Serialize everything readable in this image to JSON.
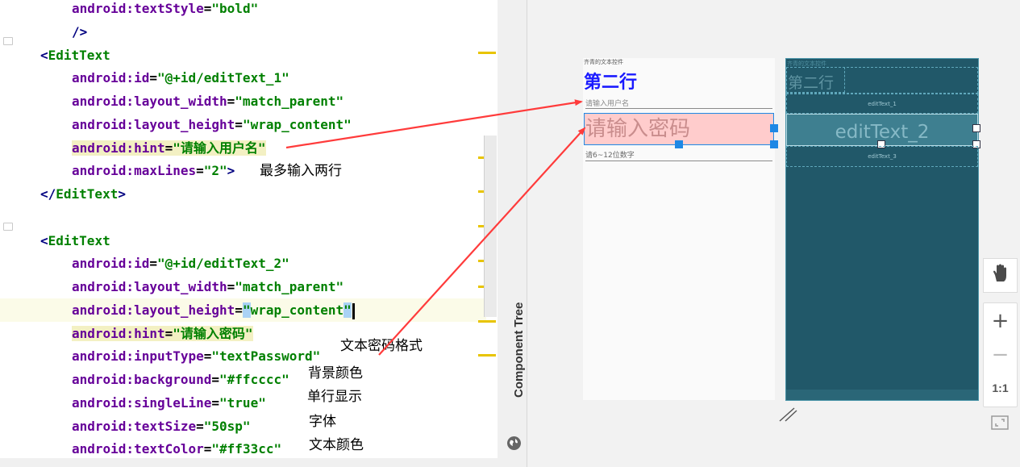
{
  "editor": {
    "lines": [
      {
        "indent": 2,
        "parts": [
          {
            "cls": "attr",
            "text": "android:textStyle"
          },
          {
            "cls": "",
            "text": "="
          },
          {
            "cls": "val",
            "text": "\"bold\""
          }
        ]
      },
      {
        "indent": 2,
        "parts": [
          {
            "cls": "tag",
            "text": "/>"
          }
        ]
      },
      {
        "indent": 1,
        "parts": [
          {
            "cls": "tag",
            "text": "<"
          },
          {
            "cls": "tagname",
            "text": "EditText"
          }
        ]
      },
      {
        "indent": 2,
        "parts": [
          {
            "cls": "attr",
            "text": "android:id"
          },
          {
            "cls": "",
            "text": "="
          },
          {
            "cls": "val",
            "text": "\"@+id/editText_1\""
          }
        ]
      },
      {
        "indent": 2,
        "parts": [
          {
            "cls": "attr",
            "text": "android:layout_width"
          },
          {
            "cls": "",
            "text": "="
          },
          {
            "cls": "val",
            "text": "\"match_parent\""
          }
        ]
      },
      {
        "indent": 2,
        "parts": [
          {
            "cls": "attr",
            "text": "android:layout_height"
          },
          {
            "cls": "",
            "text": "="
          },
          {
            "cls": "val",
            "text": "\"wrap_content\""
          }
        ]
      },
      {
        "indent": 2,
        "parts": [
          {
            "cls": "attr hintbg",
            "text": "android:hint"
          },
          {
            "cls": "hintbg",
            "text": "="
          },
          {
            "cls": "val hintbg",
            "text": "\"请输入用户名\""
          }
        ]
      },
      {
        "indent": 2,
        "parts": [
          {
            "cls": "attr",
            "text": "android:maxLines"
          },
          {
            "cls": "",
            "text": "="
          },
          {
            "cls": "val",
            "text": "\"2\""
          },
          {
            "cls": "tag",
            "text": ">"
          }
        ]
      },
      {
        "indent": 1,
        "parts": [
          {
            "cls": "tag",
            "text": "</"
          },
          {
            "cls": "tagname",
            "text": "EditText"
          },
          {
            "cls": "tag",
            "text": ">"
          }
        ]
      },
      {
        "indent": 0,
        "parts": []
      },
      {
        "indent": 1,
        "parts": [
          {
            "cls": "tag",
            "text": "<"
          },
          {
            "cls": "tagname",
            "text": "EditText"
          }
        ]
      },
      {
        "indent": 2,
        "parts": [
          {
            "cls": "attr",
            "text": "android:id"
          },
          {
            "cls": "",
            "text": "="
          },
          {
            "cls": "val",
            "text": "\"@+id/editText_2\""
          }
        ]
      },
      {
        "indent": 2,
        "parts": [
          {
            "cls": "attr",
            "text": "android:layout_width"
          },
          {
            "cls": "",
            "text": "="
          },
          {
            "cls": "val",
            "text": "\"match_parent\""
          }
        ]
      },
      {
        "indent": 2,
        "caret": true,
        "parts": [
          {
            "cls": "attr",
            "text": "android:layout_height"
          },
          {
            "cls": "",
            "text": "="
          },
          {
            "cls": "val caretbox",
            "text": "\""
          },
          {
            "cls": "val",
            "text": "wrap_content"
          },
          {
            "cls": "val caretbox",
            "text": "\""
          }
        ]
      },
      {
        "indent": 2,
        "parts": [
          {
            "cls": "attr hintbg",
            "text": "android:hint"
          },
          {
            "cls": "hintbg",
            "text": "="
          },
          {
            "cls": "val hintbg",
            "text": "\"请输入密码\""
          }
        ]
      },
      {
        "indent": 2,
        "parts": [
          {
            "cls": "attr",
            "text": "android:inputType"
          },
          {
            "cls": "",
            "text": "="
          },
          {
            "cls": "val",
            "text": "\"textPassword\""
          }
        ]
      },
      {
        "indent": 2,
        "parts": [
          {
            "cls": "attr",
            "text": "android:background"
          },
          {
            "cls": "",
            "text": "="
          },
          {
            "cls": "val",
            "text": "\"#ffcccc\""
          }
        ]
      },
      {
        "indent": 2,
        "parts": [
          {
            "cls": "attr",
            "text": "android:singleLine"
          },
          {
            "cls": "",
            "text": "="
          },
          {
            "cls": "val",
            "text": "\"true\""
          }
        ]
      },
      {
        "indent": 2,
        "parts": [
          {
            "cls": "attr",
            "text": "android:textSize"
          },
          {
            "cls": "",
            "text": "="
          },
          {
            "cls": "val",
            "text": "\"50sp\""
          }
        ]
      },
      {
        "indent": 2,
        "parts": [
          {
            "cls": "attr",
            "text": "android:textColor"
          },
          {
            "cls": "",
            "text": "="
          },
          {
            "cls": "val",
            "text": "\"#ff33cc\""
          }
        ]
      },
      {
        "indent": 2,
        "parts": [
          {
            "cls": "tag",
            "text": "/>"
          }
        ]
      }
    ],
    "highlighted_line": 13
  },
  "notes": {
    "max_lines": "最多输入两行",
    "password_format": "文本密码格式",
    "background_color": "背景颜色",
    "single_line": "单行显示",
    "font": "字体",
    "text_color": "文本颜色"
  },
  "design": {
    "component_tree_label": "Component Tree",
    "preview": {
      "caption": "齐青的文本控件",
      "title": "第二行",
      "username_hint": "请输入用户名",
      "password_hint": "请输入密码",
      "third_hint": "请6~12位数字",
      "title_color": "#1a1aff",
      "password_bg": "#ffcccc",
      "password_hint_color": "#c98d8d"
    },
    "blueprint": {
      "caption": "齐青的文本控件",
      "title": "第二行",
      "label_1": "editText_1",
      "label_2": "editText_2",
      "label_3": "editText_3",
      "bg": "#215869"
    },
    "toolbar": {
      "pan_icon": "hand-icon",
      "zoom_in_label": "+",
      "zoom_out_label": "−",
      "actual_size_label": "1:1",
      "fit_icon": "fit-screen-icon"
    }
  },
  "colors": {
    "arrow": "#ff3b3b",
    "attr": "#660099",
    "value": "#008000",
    "tag": "#000080"
  }
}
